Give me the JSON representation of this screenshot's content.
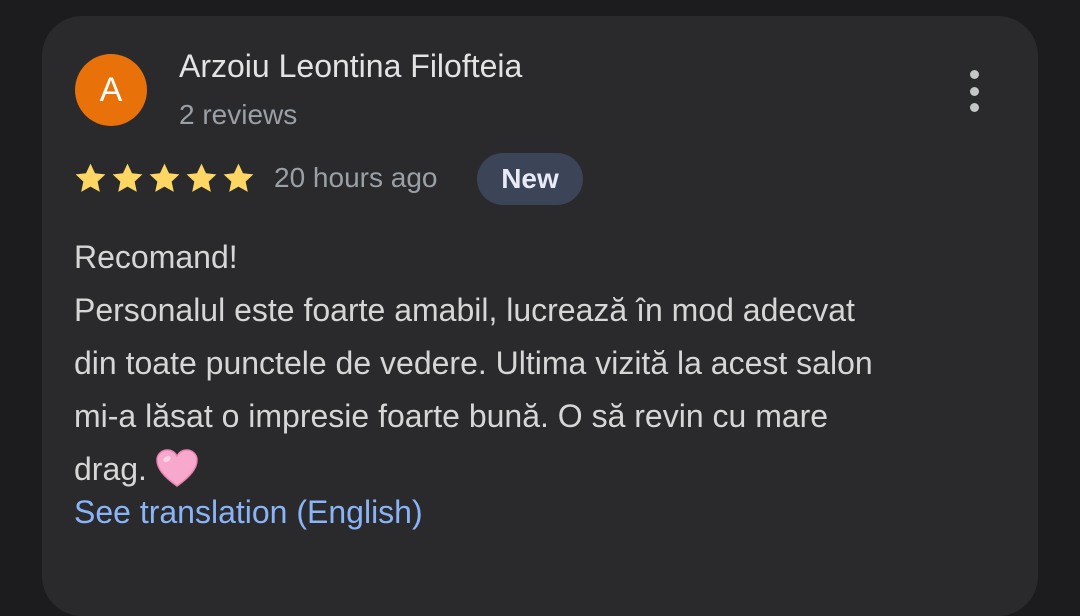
{
  "review": {
    "avatar_letter": "A",
    "avatar_color": "#e8710a",
    "author_name": "Arzoiu Leontina Filofteia",
    "author_reviews": "2 reviews",
    "rating": 5,
    "rating_max": 5,
    "time_ago": "20 hours ago",
    "badge": "New",
    "text_lines": [
      "Recomand!",
      "Personalul este foarte amabil, lucrează în mod adecvat",
      "din toate punctele de vedere. Ultima vizită la acest salon",
      "mi-a lăsat o impresie foarte bună. O să revin cu mare",
      "drag."
    ],
    "emoji": "pink-heart-icon",
    "translate_link": "See translation (English)",
    "more_icon": "more-vert-icon",
    "star_color": "#fdd663",
    "link_color": "#8ab4f8"
  }
}
